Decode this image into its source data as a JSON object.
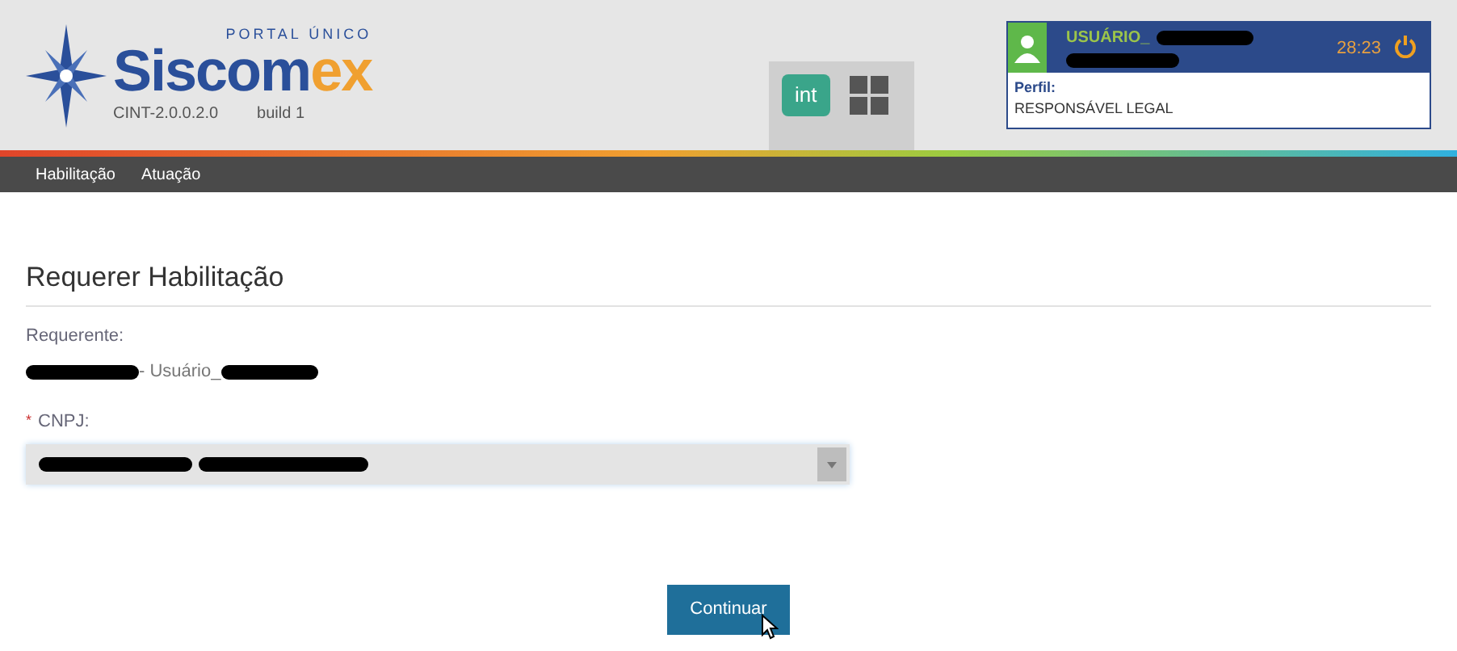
{
  "header": {
    "logo": {
      "tagline": "PORTAL ÚNICO",
      "name_main": "Siscom",
      "name_accent": "ex",
      "version": "CINT-2.0.0.2.0",
      "build": "build 1"
    },
    "switcher": {
      "active_label": "int"
    },
    "user": {
      "label": "USUÁRIO_",
      "timer": "28:23",
      "profile_label": "Perfil:",
      "profile": "RESPONSÁVEL LEGAL"
    }
  },
  "nav": {
    "items": [
      {
        "label": "Habilitação"
      },
      {
        "label": "Atuação"
      }
    ]
  },
  "page": {
    "title": "Requerer Habilitação",
    "requester": {
      "label": "Requerente:",
      "value_middle": "- Usuário_"
    },
    "cnpj": {
      "label": "CNPJ:",
      "required_mark": "*"
    },
    "submit": "Continuar"
  }
}
